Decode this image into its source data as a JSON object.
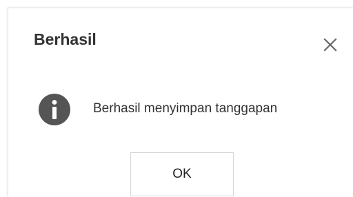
{
  "dialog": {
    "title": "Berhasil",
    "message": "Berhasil menyimpan tanggapan",
    "ok_label": "OK",
    "icons": {
      "close": "close-icon",
      "info": "info-icon"
    }
  },
  "colors": {
    "title_text": "#333333",
    "info_icon_bg": "#555555",
    "close_icon": "#666666",
    "button_border": "#d7d7d7"
  }
}
